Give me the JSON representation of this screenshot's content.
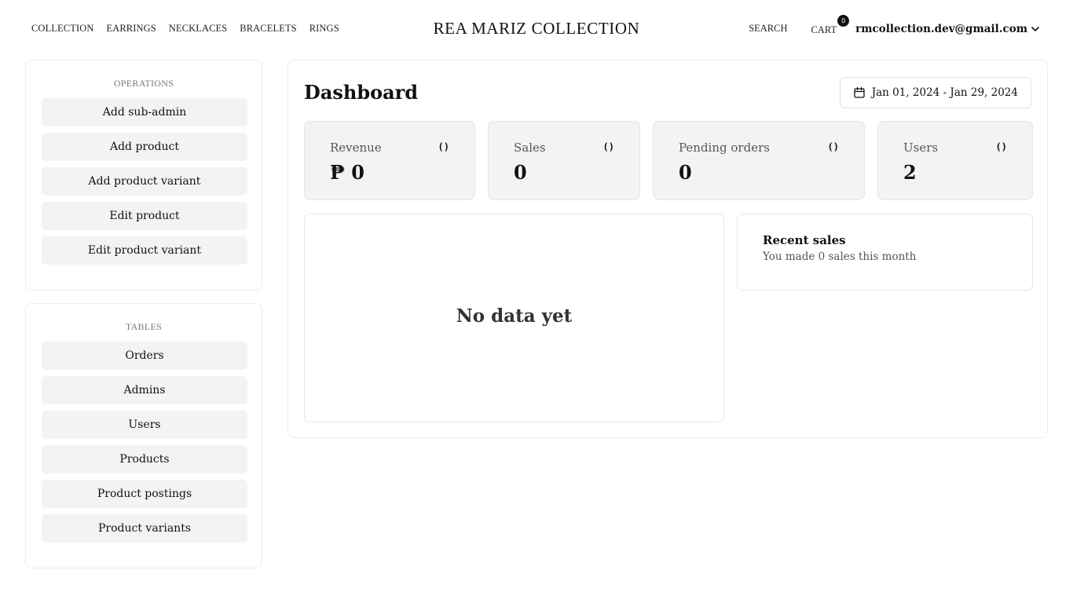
{
  "nav": {
    "links": [
      "COLLECTION",
      "EARRINGS",
      "NECKLACES",
      "BRACELETS",
      "RINGS"
    ],
    "brand": "REA MARIZ COLLECTION",
    "search_label": "SEARCH",
    "cart_label": "CART",
    "cart_count": "0",
    "account_email": "rmcollection.dev@gmail.com"
  },
  "sidebar": {
    "operations": {
      "title": "OPERATIONS",
      "items": [
        "Add sub-admin",
        "Add product",
        "Add product variant",
        "Edit product",
        "Edit product variant"
      ]
    },
    "tables": {
      "title": "TABLES",
      "items": [
        "Orders",
        "Admins",
        "Users",
        "Products",
        "Product postings",
        "Product variants"
      ]
    }
  },
  "main": {
    "title": "Dashboard",
    "date_range": "Jan 01, 2024 - Jan 29, 2024",
    "stats": [
      {
        "label": "Revenue",
        "icon": "()",
        "value": "₱ 0"
      },
      {
        "label": "Sales",
        "icon": "()",
        "value": "0"
      },
      {
        "label": "Pending orders",
        "icon": "()",
        "value": "0"
      },
      {
        "label": "Users",
        "icon": "()",
        "value": "2"
      }
    ],
    "chart_empty_text": "No data yet",
    "recent_sales": {
      "title": "Recent sales",
      "subtitle": "You made 0 sales this month"
    }
  },
  "icons": {
    "calendar": "calendar-icon",
    "chevron": "chevron-down-icon"
  }
}
